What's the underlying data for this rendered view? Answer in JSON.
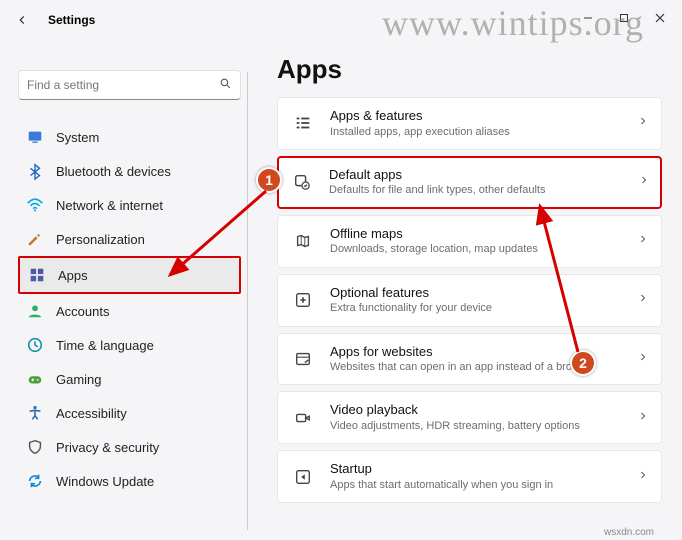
{
  "titlebar": {
    "title": "Settings"
  },
  "watermark": "www.wintips.org",
  "attribution": "wsxdn.com",
  "search": {
    "placeholder": "Find a setting"
  },
  "sidebar": {
    "items": [
      {
        "label": "System",
        "icon": "system-icon",
        "color": "#3a7ad9"
      },
      {
        "label": "Bluetooth & devices",
        "icon": "bluetooth-icon",
        "color": "#1b63c7"
      },
      {
        "label": "Network & internet",
        "icon": "network-icon",
        "color": "#00a8e8"
      },
      {
        "label": "Personalization",
        "icon": "personalization-icon",
        "color": "#c27a2c"
      },
      {
        "label": "Apps",
        "icon": "apps-icon",
        "color": "#4a5ca8",
        "active": true,
        "boxed": true
      },
      {
        "label": "Accounts",
        "icon": "accounts-icon",
        "color": "#2cae66"
      },
      {
        "label": "Time & language",
        "icon": "time-icon",
        "color": "#1793a5"
      },
      {
        "label": "Gaming",
        "icon": "gaming-icon",
        "color": "#4aa33a"
      },
      {
        "label": "Accessibility",
        "icon": "accessibility-icon",
        "color": "#2a6fb0"
      },
      {
        "label": "Privacy & security",
        "icon": "privacy-icon",
        "color": "#555"
      },
      {
        "label": "Windows Update",
        "icon": "update-icon",
        "color": "#0b88d8"
      }
    ]
  },
  "page": {
    "title": "Apps"
  },
  "cards": [
    {
      "title": "Apps & features",
      "sub": "Installed apps, app execution aliases"
    },
    {
      "title": "Default apps",
      "sub": "Defaults for file and link types, other defaults",
      "highlight": true
    },
    {
      "title": "Offline maps",
      "sub": "Downloads, storage location, map updates"
    },
    {
      "title": "Optional features",
      "sub": "Extra functionality for your device"
    },
    {
      "title": "Apps for websites",
      "sub": "Websites that can open in an app instead of a browser"
    },
    {
      "title": "Video playback",
      "sub": "Video adjustments, HDR streaming, battery options"
    },
    {
      "title": "Startup",
      "sub": "Apps that start automatically when you sign in"
    }
  ],
  "annotations": {
    "one": "1",
    "two": "2"
  }
}
